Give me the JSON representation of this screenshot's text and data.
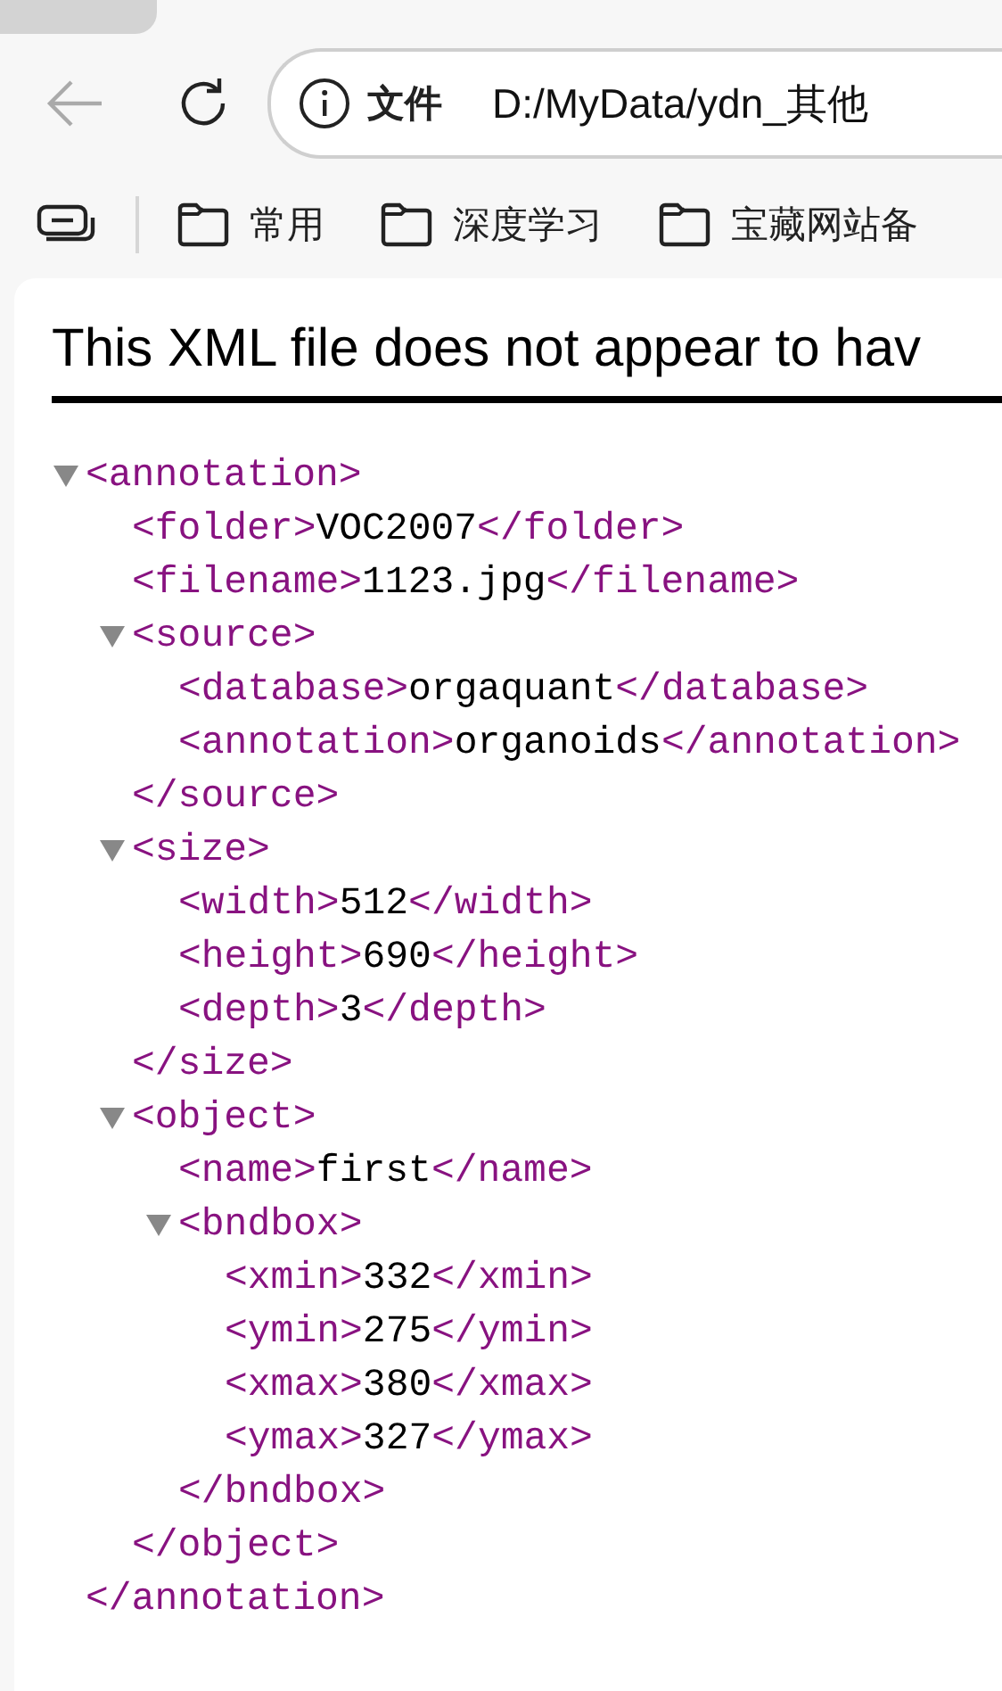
{
  "browser": {
    "back": {
      "disabled": true
    },
    "address": {
      "scheme": "文件",
      "url": "D:/MyData/ydn_其他"
    },
    "bookmarks": [
      {
        "label": "常用"
      },
      {
        "label": "深度学习"
      },
      {
        "label": "宝藏网站备"
      }
    ]
  },
  "heading": "This XML file does not appear to hav",
  "tree": {
    "open": "<annotation>",
    "close": "</annotation>",
    "expanded": true,
    "children": [
      {
        "open": "<folder>",
        "text": "VOC2007",
        "close": "</folder>"
      },
      {
        "open": "<filename>",
        "text": "1123.jpg",
        "close": "</filename>"
      },
      {
        "open": "<source>",
        "close": "</source>",
        "expanded": true,
        "children": [
          {
            "open": "<database>",
            "text": "orgaquant",
            "close": "</database>"
          },
          {
            "open": "<annotation>",
            "text": "organoids",
            "close": "</annotation>"
          }
        ]
      },
      {
        "open": "<size>",
        "close": "</size>",
        "expanded": true,
        "children": [
          {
            "open": "<width>",
            "text": "512",
            "close": "</width>"
          },
          {
            "open": "<height>",
            "text": "690",
            "close": "</height>"
          },
          {
            "open": "<depth>",
            "text": "3",
            "close": "</depth>"
          }
        ]
      },
      {
        "open": "<object>",
        "close": "</object>",
        "expanded": true,
        "children": [
          {
            "open": "<name>",
            "text": "first",
            "close": "</name>"
          },
          {
            "open": "<bndbox>",
            "close": "</bndbox>",
            "expanded": true,
            "children": [
              {
                "open": "<xmin>",
                "text": "332",
                "close": "</xmin>"
              },
              {
                "open": "<ymin>",
                "text": "275",
                "close": "</ymin>"
              },
              {
                "open": "<xmax>",
                "text": "380",
                "close": "</xmax>"
              },
              {
                "open": "<ymax>",
                "text": "327",
                "close": "</ymax>"
              }
            ]
          }
        ]
      }
    ]
  }
}
